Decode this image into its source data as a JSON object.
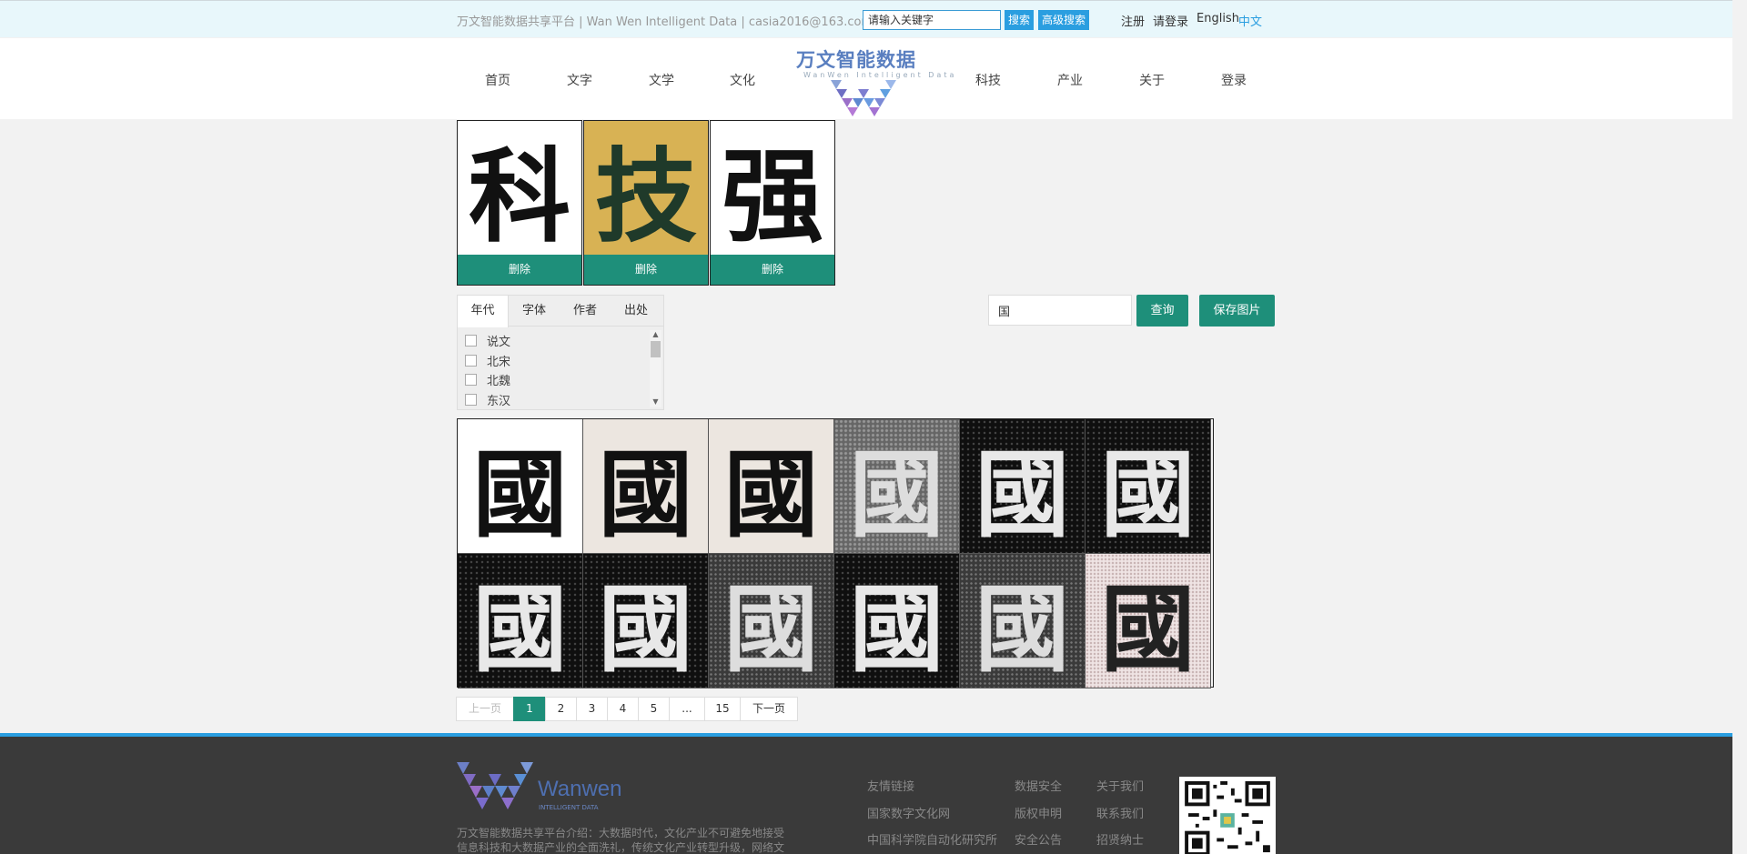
{
  "topbar": {
    "intro": "万文智能数据共享平台 | Wan Wen Intelligent Data | casia2016@163.com",
    "search_placeholder": "请输入关键字",
    "search_button": "搜索",
    "advanced_search_button": "高级搜索",
    "register": "注册",
    "login": "请登录",
    "lang_en": "English",
    "lang_zh": "中文"
  },
  "nav": {
    "items": [
      "首页",
      "文字",
      "文学",
      "文化",
      "科技",
      "产业",
      "关于",
      "登录"
    ],
    "logo_text": "万文智能数据",
    "logo_sub": "WanWen Intelligent Data"
  },
  "selected": [
    {
      "char": "科",
      "delete_label": "删除"
    },
    {
      "char": "技",
      "delete_label": "删除"
    },
    {
      "char": "强",
      "delete_label": "删除"
    }
  ],
  "filter": {
    "tabs": [
      "年代",
      "字体",
      "作者",
      "出处"
    ],
    "active_tab": "年代",
    "options": [
      "说文",
      "北宋",
      "北魏",
      "东汉"
    ]
  },
  "query": {
    "value": "国",
    "query_button": "查询",
    "save_button": "保存图片"
  },
  "results": [
    "國",
    "國",
    "國",
    "國",
    "國",
    "國",
    "國",
    "國",
    "國",
    "國",
    "國",
    "國"
  ],
  "pagination": {
    "prev": "上一页",
    "pages": [
      "1",
      "2",
      "3",
      "4",
      "5",
      "...",
      "15"
    ],
    "current": "1",
    "next": "下一页"
  },
  "footer": {
    "brand": "Wanwen",
    "brand_sub": "INTELLIGENT DATA",
    "intro": "万文智能数据共享平台介绍：大数据时代，文化产业不可避免地接受信息科技和大数据产业的全面洗礼，传统文化产业转型升级，网络文艺蓬",
    "col1": [
      "友情链接",
      "国家数字文化网",
      "中国科学院自动化研究所"
    ],
    "col2": [
      "数据安全",
      "版权申明",
      "安全公告"
    ],
    "col3": [
      "关于我们",
      "联系我们",
      "招贤纳士"
    ]
  },
  "colors": {
    "accent_green": "#1e8f7a",
    "accent_blue": "#2a9ee0",
    "logo_purple": "#5a7fc0"
  }
}
